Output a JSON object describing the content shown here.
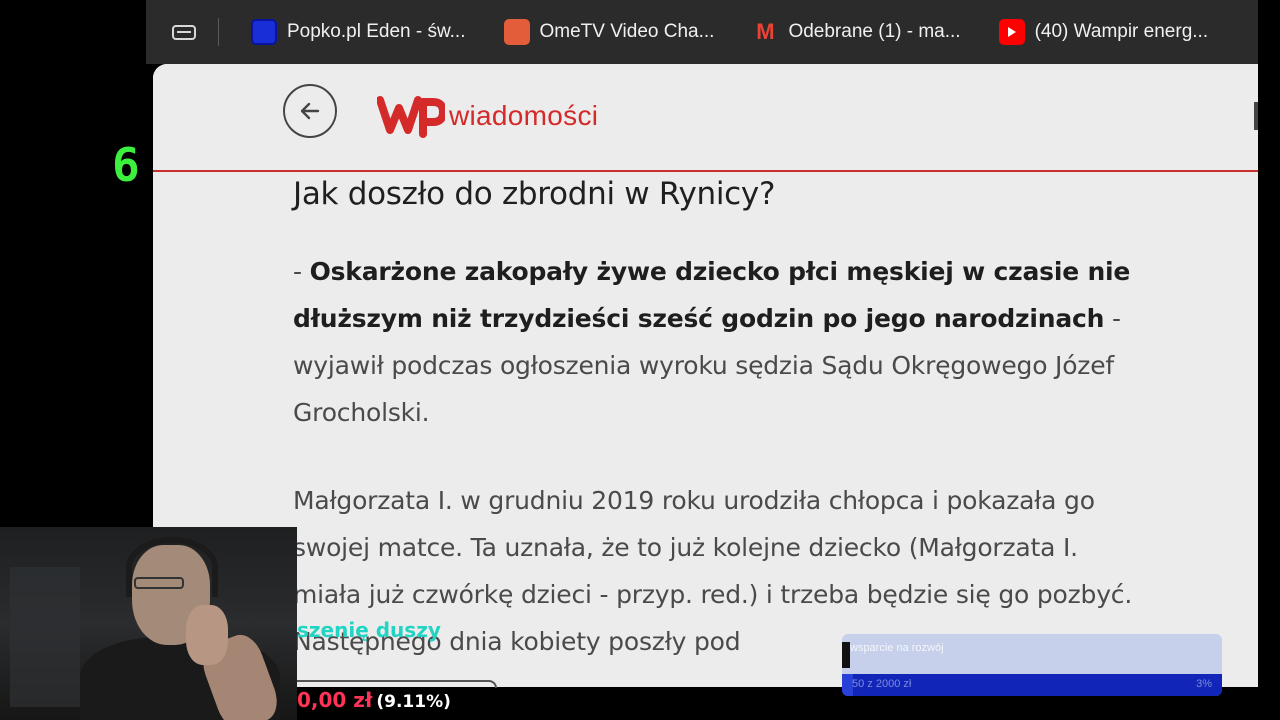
{
  "side_number": "6",
  "tabs": [
    {
      "title": "Popko.pl Eden - św...",
      "icon": "popko-favicon"
    },
    {
      "title": "OmeTV Video Cha...",
      "icon": "ometv-favicon"
    },
    {
      "title": "Odebrane (1) - ma...",
      "icon": "gmail-favicon"
    },
    {
      "title": "(40) Wampir energ...",
      "icon": "youtube-favicon"
    }
  ],
  "site": {
    "logo_text": "wiadomości",
    "accent_color": "#d42a2a"
  },
  "article": {
    "heading": "Jak doszło do zbrodni w Rynicy?",
    "p1_dash": "- ",
    "p1_bold": "Oskarżone zakopały żywe dziecko płci męskiej w czasie nie dłuższym niż trzydzieści sześć godzin po jego narodzinach",
    "p1_rest": " - wyjawił podczas ogłoszenia wyroku sędzia Sądu Okręgowego Józef Grocholski.",
    "p2": "Małgorzata I. w grudniu 2019 roku urodziła chłopca i pokazała go swojej matce. Ta uznała, że to już kolejne dziecko (Małgorzata I. miała już czwórkę dzieci - przyp. red.) i trzeba będzie się go pozbyć. Następnego dnia kobiety poszły pod"
  },
  "overlay": {
    "cam_text": "szenię duszy",
    "donation_amount": "0,00 zł",
    "donation_percent": "(9.11%)",
    "goal_title": "wsparcie na rozwój",
    "goal_left": "50 z 2000 zł",
    "goal_right": "3%",
    "goal_progress": 0.03
  }
}
